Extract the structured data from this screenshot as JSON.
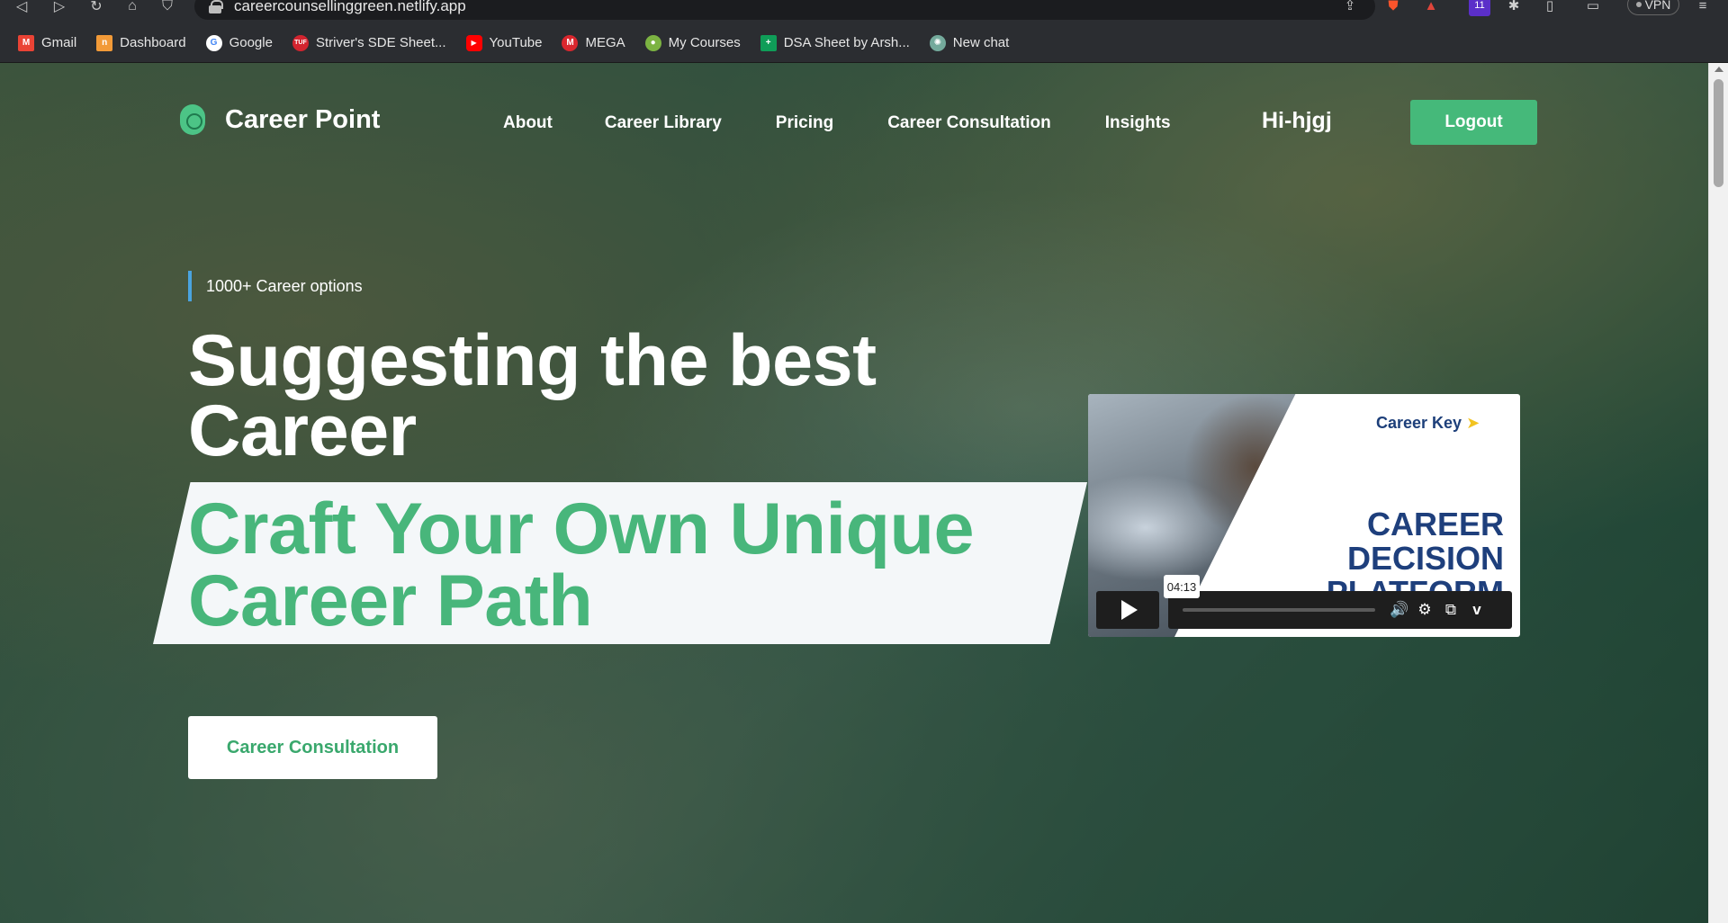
{
  "browser": {
    "url": "careercounsellinggreen.netlify.app",
    "vpn_label": "VPN",
    "bookmarks": [
      {
        "label": "Gmail",
        "icon": "gmail-icon",
        "color": "#ea4335"
      },
      {
        "label": "Dashboard",
        "icon": "dashboard-icon",
        "color": "#f29a38"
      },
      {
        "label": "Google",
        "icon": "google-icon",
        "color": "#4285f4"
      },
      {
        "label": "Striver's SDE Sheet...",
        "icon": "striver-icon",
        "color": "#d3242f"
      },
      {
        "label": "YouTube",
        "icon": "youtube-icon",
        "color": "#ff0000"
      },
      {
        "label": "MEGA",
        "icon": "mega-icon",
        "color": "#d9272e"
      },
      {
        "label": "My Courses",
        "icon": "courses-icon",
        "color": "#7cb342"
      },
      {
        "label": "DSA Sheet by Arsh...",
        "icon": "sheets-icon",
        "color": "#0f9d58"
      },
      {
        "label": "New chat",
        "icon": "chatgpt-icon",
        "color": "#74aa9c"
      }
    ],
    "notification_badge": "11"
  },
  "header": {
    "brand": "Career Point",
    "nav": [
      "About",
      "Career Library",
      "Pricing",
      "Career Consultation",
      "Insights"
    ],
    "greeting": "Hi-hjgj",
    "logout_label": "Logout"
  },
  "hero": {
    "eyebrow": "1000+ Career options",
    "title": "Suggesting the best Career",
    "highlight": "Craft Your Own Unique Career Path",
    "cta_label": "Career Consultation"
  },
  "video": {
    "brand": "Career Key",
    "headline": "CAREER DECISION PLATFORM",
    "duration": "04:13",
    "progress": 0.0
  },
  "colors": {
    "accent_green": "#45b97a",
    "brand_blue": "#1e3f7c"
  }
}
